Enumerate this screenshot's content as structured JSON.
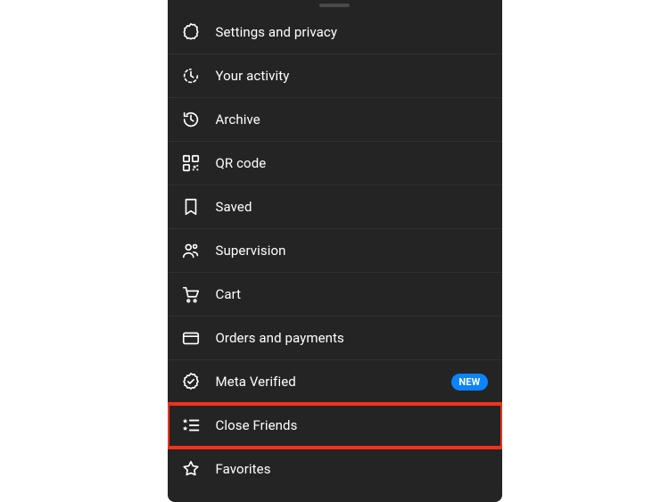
{
  "menu": {
    "items": [
      {
        "label": "Settings and privacy"
      },
      {
        "label": "Your activity"
      },
      {
        "label": "Archive"
      },
      {
        "label": "QR code"
      },
      {
        "label": "Saved"
      },
      {
        "label": "Supervision"
      },
      {
        "label": "Cart"
      },
      {
        "label": "Orders and payments"
      },
      {
        "label": "Meta Verified",
        "badge": "NEW"
      },
      {
        "label": "Close Friends"
      },
      {
        "label": "Favorites"
      }
    ]
  }
}
